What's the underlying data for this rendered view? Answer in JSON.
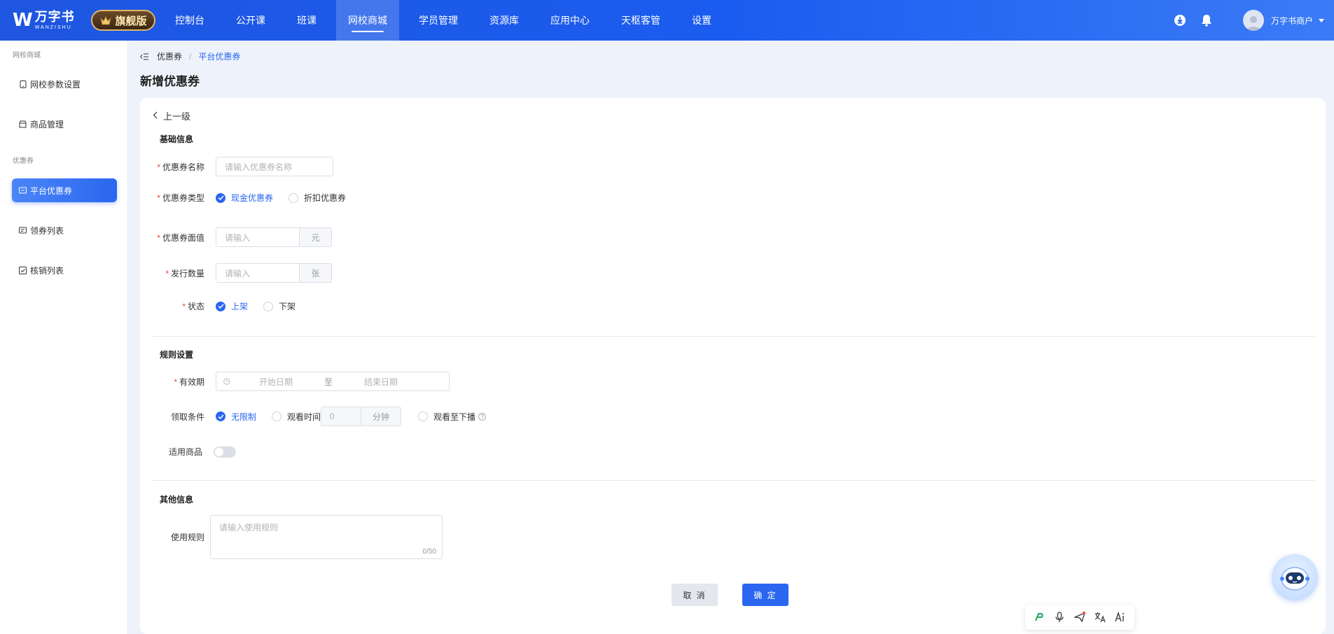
{
  "brand": {
    "name_cn": "万字书",
    "name_en": "WANZISHU",
    "edition": "旗舰版"
  },
  "nav": {
    "items": [
      "控制台",
      "公开课",
      "班课",
      "网校商城",
      "学员管理",
      "资源库",
      "应用中心",
      "天枢客管",
      "设置"
    ],
    "active_index": 3
  },
  "user": {
    "name": "万字书商户"
  },
  "sidebar": {
    "group1": "网校商城",
    "item_settings": "网校参数设置",
    "item_goods": "商品管理",
    "group2": "优惠券",
    "item_platform_coupon": "平台优惠券",
    "item_claim_list": "领券列表",
    "item_redeem_list": "核销列表"
  },
  "breadcrumb": {
    "parent": "优惠券",
    "separator": "/",
    "current": "平台优惠券"
  },
  "page": {
    "title": "新增优惠券",
    "back": "上一级"
  },
  "basic": {
    "title": "基础信息",
    "name_label": "优惠券名称",
    "name_placeholder": "请输入优惠券名称",
    "type_label": "优惠券类型",
    "type_cash": "现金优惠券",
    "type_discount": "折扣优惠券",
    "value_label": "优惠券面值",
    "value_placeholder": "请输入",
    "value_unit": "元",
    "qty_label": "发行数量",
    "qty_placeholder": "请输入",
    "qty_unit": "张",
    "status_label": "状态",
    "status_on": "上架",
    "status_off": "下架"
  },
  "rules": {
    "title": "规则设置",
    "validity_label": "有效期",
    "start_placeholder": "开始日期",
    "to": "至",
    "end_placeholder": "结束日期",
    "condition_label": "领取条件",
    "cond_unlimited": "无限制",
    "cond_watch_time": "观看时间",
    "watch_value": "0",
    "watch_unit": "分钟",
    "cond_watch_end": "观看至下播",
    "help_mark": "?",
    "goods_label": "适用商品"
  },
  "other": {
    "title": "其他信息",
    "rules_label": "使用规则",
    "rules_placeholder": "请输入使用规则",
    "count": "0/50"
  },
  "actions": {
    "cancel": "取 消",
    "ok": "确 定"
  },
  "required_mark": "*",
  "colors": {
    "primary": "#2a66f0",
    "nav_bg": "#1e56e0",
    "required": "#f2453d"
  }
}
